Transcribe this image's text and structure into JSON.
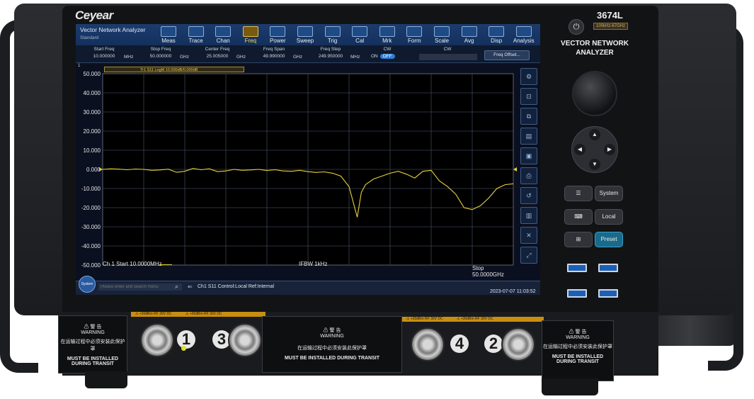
{
  "brand": "Ceyear",
  "model": "3674L",
  "freq_range": "100kHz-67GHz",
  "product_name_line1": "VECTOR NETWORK",
  "product_name_line2": "ANALYZER",
  "app": {
    "title": "Vector Network Analyzer",
    "subtitle": "Standard"
  },
  "toolbar": [
    {
      "label": "Meas",
      "icon": "measure-icon"
    },
    {
      "label": "Trace",
      "icon": "trace-icon"
    },
    {
      "label": "Chan",
      "icon": "channel-icon"
    },
    {
      "label": "Freq",
      "icon": "frequency-icon",
      "active": true
    },
    {
      "label": "Power",
      "icon": "power-level-icon"
    },
    {
      "label": "Sweep",
      "icon": "sweep-icon"
    },
    {
      "label": "Trig",
      "icon": "trigger-icon"
    },
    {
      "label": "Cal",
      "icon": "calibration-icon"
    },
    {
      "label": "Mrk",
      "icon": "marker-icon"
    },
    {
      "label": "Form",
      "icon": "format-icon"
    },
    {
      "label": "Scale",
      "icon": "scale-icon"
    },
    {
      "label": "Avg",
      "icon": "average-icon"
    },
    {
      "label": "Disp",
      "icon": "display-icon"
    },
    {
      "label": "Analysis",
      "icon": "analysis-icon"
    }
  ],
  "params": {
    "start": {
      "label": "Start Freq",
      "value": "10.000000",
      "unit": "MHz"
    },
    "stop": {
      "label": "Stop Freq",
      "value": "50.000000",
      "unit": "GHz"
    },
    "center": {
      "label": "Center Freq",
      "value": "25.005000",
      "unit": "GHz"
    },
    "span": {
      "label": "Freq Span",
      "value": "49.990000",
      "unit": "GHz"
    },
    "step": {
      "label": "Freq Step",
      "value": "249.950000",
      "unit": "MHz"
    },
    "cw_label": "CW",
    "cw_on": "ON",
    "cw_off": "OFF",
    "cw_field_label": "CW",
    "freq_offset": "Freq Offset..."
  },
  "trace_label": "Tr1 S11 LogM 10.000dB/0.000dB",
  "channel_badge": "1",
  "chart_data": {
    "type": "line",
    "y_ticks": [
      "50.000",
      "40.000",
      "30.000",
      "20.000",
      "10.000",
      "0.000",
      "-10.000",
      "-20.000",
      "-30.000",
      "-40.000",
      "-50.000"
    ],
    "ylim": [
      -50,
      50
    ],
    "xlim": [
      0.01,
      50
    ],
    "grid": true,
    "series": [
      {
        "color": "#e8d23a",
        "x": [
          0.01,
          1,
          2,
          3,
          4,
          5,
          6,
          7,
          8,
          9,
          10,
          11,
          12,
          13,
          14,
          15,
          16,
          17,
          18,
          19,
          20,
          21,
          22,
          23,
          24,
          25,
          26,
          27,
          28,
          29,
          30,
          30.5,
          31,
          31.5,
          32,
          33,
          34,
          35,
          36,
          37,
          38,
          39,
          40,
          41,
          42,
          43,
          44,
          45,
          46,
          47,
          48,
          49,
          50
        ],
        "y": [
          0,
          0.3,
          0.1,
          -0.2,
          0.2,
          0,
          -0.5,
          -0.3,
          0.1,
          -1.5,
          -1.0,
          0.5,
          -0.2,
          0.3,
          -1.2,
          -0.8,
          0,
          -0.5,
          -0.3,
          0,
          -0.6,
          -0.2,
          -0.8,
          -1.0,
          -0.5,
          -1.2,
          -1.6,
          -1.3,
          -2.0,
          -3.5,
          -9.0,
          -17.0,
          -25.0,
          -12.0,
          -8.0,
          -5.0,
          -3.5,
          -2.0,
          -1.0,
          -2.5,
          -4.5,
          -1.0,
          -0.5,
          -6.0,
          -9.0,
          -13.0,
          -20.0,
          -21.0,
          -19.0,
          -15.0,
          -10.0,
          -8.0,
          -7.5
        ]
      }
    ],
    "reference_markers": true
  },
  "status": {
    "start": "Ch 1 Start 10.0000MHz",
    "ifbw": "IFBW 1kHz",
    "stop": "Stop 50.0000GHz"
  },
  "bottom": {
    "system_label": "System",
    "search_placeholder": "Please enter and search menu",
    "status_text": "Ch1 S11 Control:Local Ref:Internal",
    "datetime": "2023-07-07 11:03:52"
  },
  "hw_buttons": {
    "menu_icon": "menu-icon",
    "system": "System",
    "keyboard_icon": "keyboard-icon",
    "local": "Local",
    "windows_icon": "windows-icon",
    "preset": "Preset"
  },
  "ports": [
    {
      "number": "1",
      "rating": "⚠ +30dBm RF 30V DC"
    },
    {
      "number": "3",
      "rating": "⚠ +30dBm RF 30V DC"
    },
    {
      "number": "4",
      "rating": "⚠ +30dBm RF 30V DC"
    },
    {
      "number": "2",
      "rating": "⚠ +30dBm RF 30V DC"
    }
  ],
  "warning": {
    "cn_title": "警 告",
    "en_title": "WARNING",
    "cn_text": "在运输过程中必须安装此保护罩",
    "en_text": "MUST BE INSTALLED DURING TRANSIT"
  }
}
